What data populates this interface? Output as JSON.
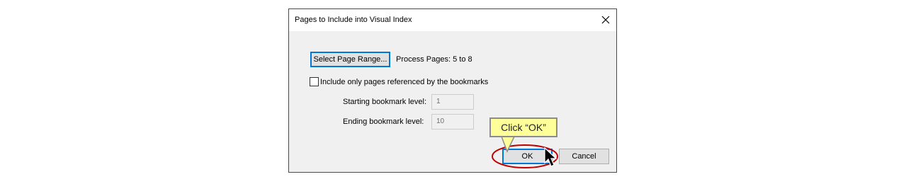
{
  "dialog": {
    "title": "Pages to Include into Visual Index",
    "select_range_label": "Select Page Range...",
    "process_pages_text": "Process Pages: 5 to 8",
    "checkbox_label": "Include only pages referenced by the bookmarks",
    "checkbox_checked": false,
    "starting_level_label": "Starting bookmark level:",
    "starting_level_value": "1",
    "ending_level_label": "Ending bookmark level:",
    "ending_level_value": "10",
    "ok_label": "OK",
    "cancel_label": "Cancel"
  },
  "annotation": {
    "callout_text": "Click “OK”",
    "highlight_color": "#c00000",
    "callout_color": "#ffff99"
  },
  "icons": {
    "close": "close-icon",
    "cursor": "mouse-pointer-icon"
  }
}
